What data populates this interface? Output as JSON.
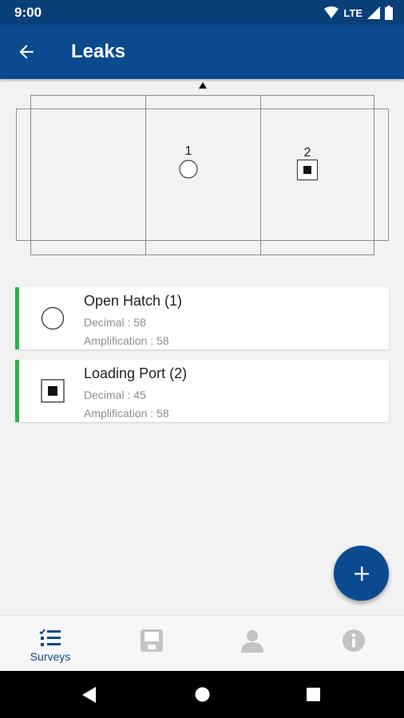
{
  "status_bar": {
    "time": "9:00",
    "network": "LTE"
  },
  "app_bar": {
    "title": "Leaks"
  },
  "diagram": {
    "markers": [
      {
        "label": "1",
        "shape": "circle"
      },
      {
        "label": "2",
        "shape": "filled-square"
      }
    ]
  },
  "leaks": [
    {
      "title": "Open Hatch (1)",
      "decimal": "Decimal : 58",
      "amplification": "Amplification : 58",
      "icon": "circle-icon",
      "status_color": "#2bb34a"
    },
    {
      "title": "Loading Port (2)",
      "decimal": "Decimal : 45",
      "amplification": "Amplification : 58",
      "icon": "filled-square-icon",
      "status_color": "#2bb34a"
    }
  ],
  "bottom_nav": [
    {
      "label": "Surveys",
      "icon": "checklist-icon",
      "active": true
    },
    {
      "label": "",
      "icon": "floppy-icon",
      "active": false
    },
    {
      "label": "",
      "icon": "person-icon",
      "active": false
    },
    {
      "label": "",
      "icon": "info-icon",
      "active": false
    }
  ],
  "colors": {
    "primary": "#0b4a8f",
    "status_bar": "#0a3f7a",
    "accent_green": "#2bb34a",
    "inactive_icon": "#c3c3c3"
  }
}
